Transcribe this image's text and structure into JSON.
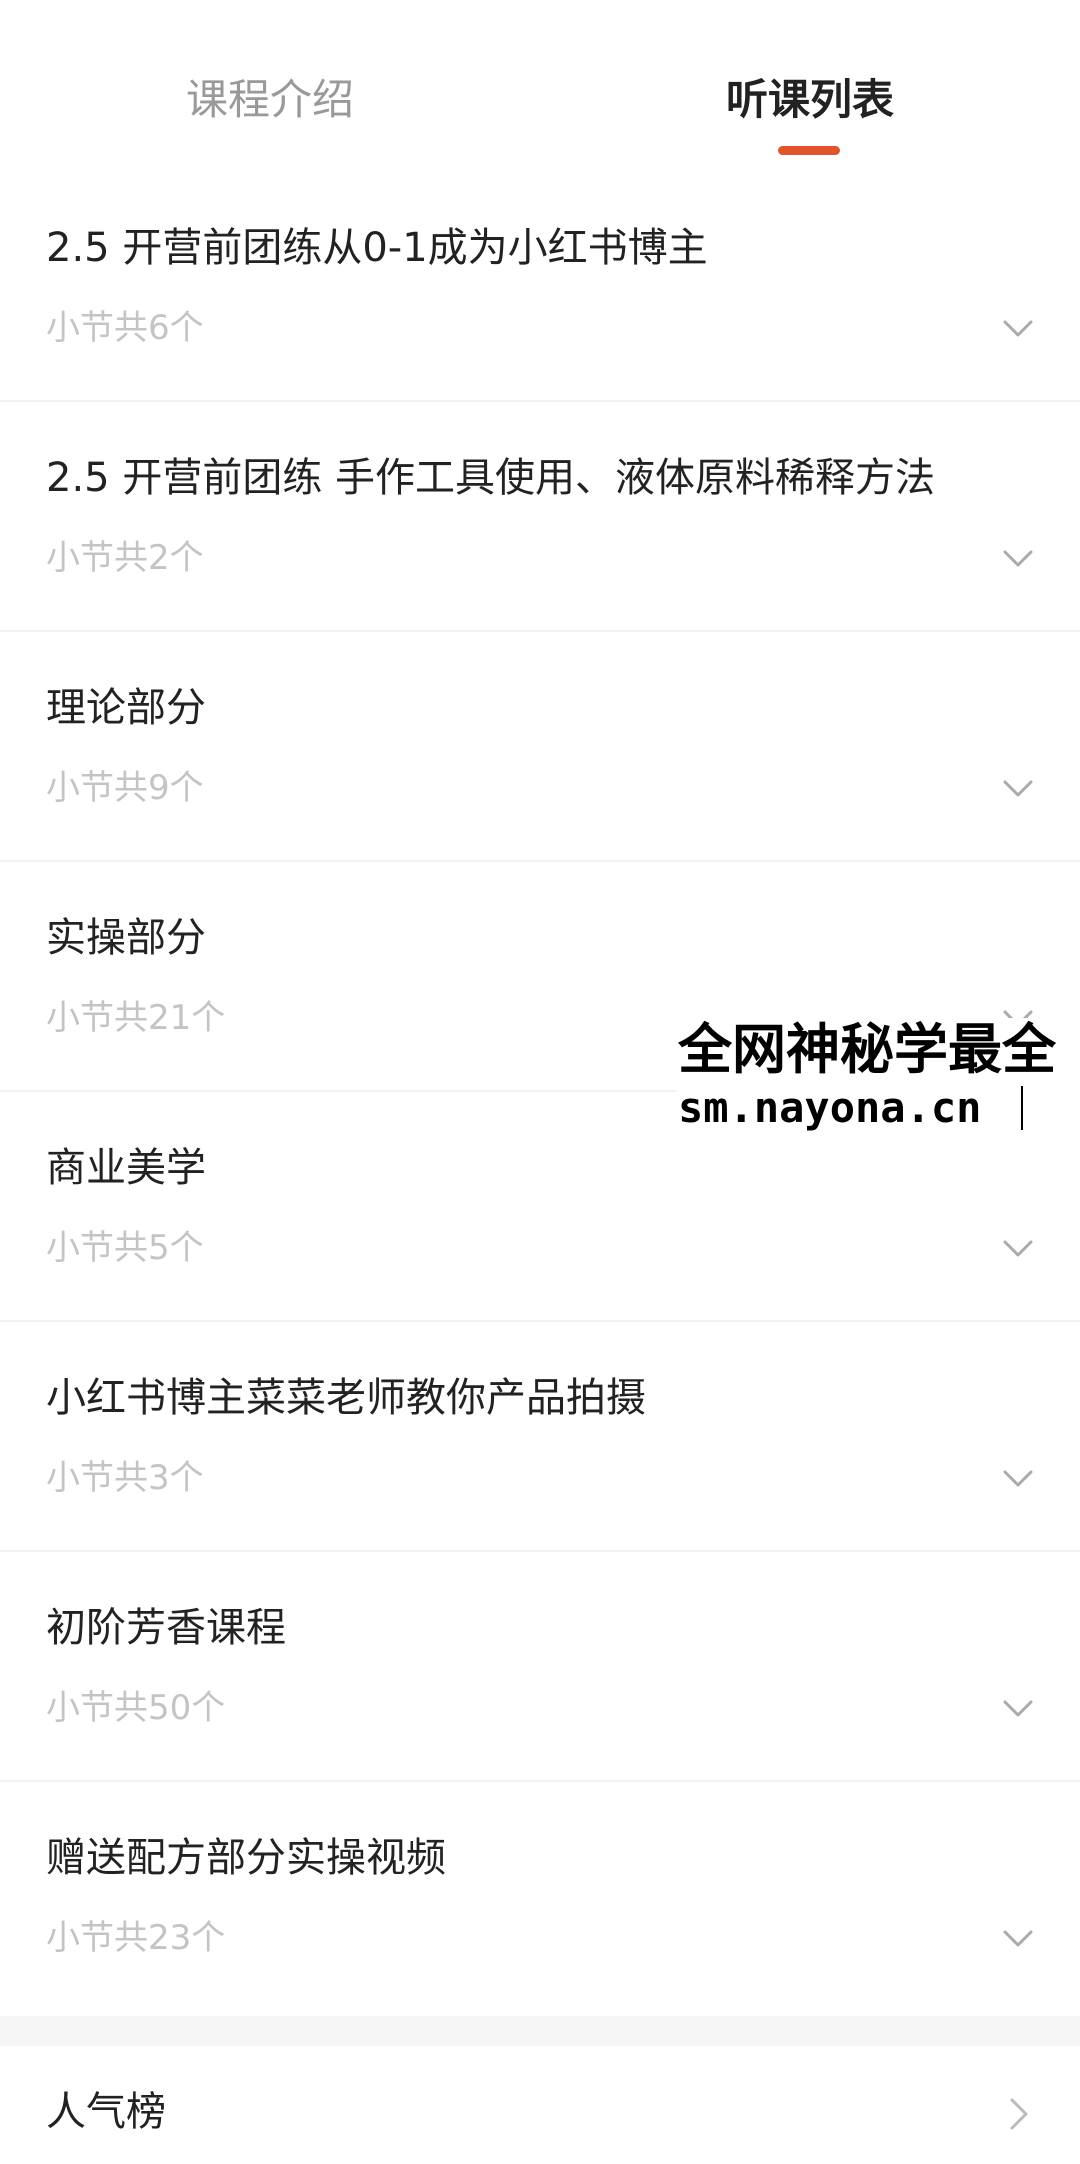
{
  "tabs": {
    "intro_label": "课程介绍",
    "list_label": "听课列表",
    "active": "听课列表",
    "accent_color": "#e2552c"
  },
  "chapters": [
    {
      "title": "2.5 开营前团练从0-1成为小红书博主",
      "subtitle": "小节共6个"
    },
    {
      "title": "2.5 开营前团练 手作工具使用、液体原料稀释方法",
      "subtitle": "小节共2个"
    },
    {
      "title": "理论部分",
      "subtitle": "小节共9个"
    },
    {
      "title": "实操部分",
      "subtitle": "小节共21个"
    },
    {
      "title": "商业美学",
      "subtitle": "小节共5个"
    },
    {
      "title": "小红书博主菜菜老师教你产品拍摄",
      "subtitle": "小节共3个"
    },
    {
      "title": "初阶芳香课程",
      "subtitle": "小节共50个"
    },
    {
      "title": "赠送配方部分实操视频",
      "subtitle": "小节共23个"
    }
  ],
  "popular": {
    "label": "人气榜"
  },
  "watermark": {
    "line1": "全网神秘学最全",
    "line2": "sm.nayona.cn"
  },
  "icons": {
    "row_toggle": "chevron-down-icon",
    "popular_arrow": "chevron-right-icon"
  }
}
